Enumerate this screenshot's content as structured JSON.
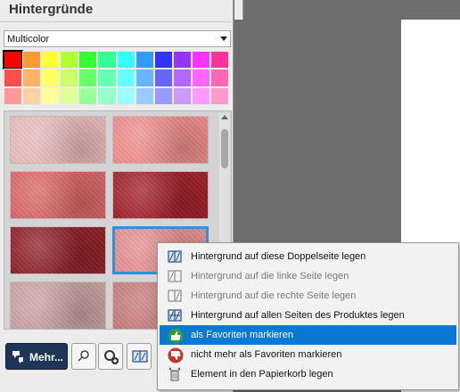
{
  "panel": {
    "title": "Hintergründe",
    "filter": {
      "value": "Multicolor"
    }
  },
  "palette": {
    "selected_index": 0,
    "rows": [
      [
        "#ff0000",
        "#ff9933",
        "#ffff33",
        "#b3ff33",
        "#33ff33",
        "#33ff99",
        "#33ffff",
        "#3399ff",
        "#3333ff",
        "#9933ff",
        "#ff33ff",
        "#ff3399"
      ],
      [
        "#ff4d4d",
        "#ffb366",
        "#ffff66",
        "#ccff66",
        "#66ff66",
        "#66ffb3",
        "#66ffff",
        "#66b3ff",
        "#6666ff",
        "#b366ff",
        "#ff66ff",
        "#ff66b3"
      ],
      [
        "#ff9999",
        "#ffd1a3",
        "#ffff99",
        "#e0ff99",
        "#99ff99",
        "#99ffcc",
        "#99ffff",
        "#99ccff",
        "#9999ff",
        "#cc99ff",
        "#ff99ff",
        "#ff99cc"
      ]
    ]
  },
  "gallery": {
    "tiles": [
      {
        "name": "pale-pink-grunge",
        "color": "#e9b9b9",
        "active": false
      },
      {
        "name": "coral-texture",
        "color": "#ef8c8c",
        "active": false
      },
      {
        "name": "brushed-red",
        "color": "#d96565",
        "active": false
      },
      {
        "name": "dark-red-grunge",
        "color": "#a11f2b",
        "active": false
      },
      {
        "name": "deep-red-vignette",
        "color": "#8e1f28",
        "active": false
      },
      {
        "name": "pink-linen",
        "color": "#e58f8f",
        "active": true
      },
      {
        "name": "crumpled-pink",
        "color": "#c9a2a2",
        "active": false
      },
      {
        "name": "red-canvas",
        "color": "#c77b7b",
        "active": false
      }
    ]
  },
  "toolbar": {
    "more_label": "Mehr..."
  },
  "context_menu": {
    "items": [
      {
        "label": "Hintergrund auf diese Doppelseite legen",
        "icon": "double-page-icon",
        "enabled": true,
        "highlighted": false
      },
      {
        "label": "Hintergrund auf die linke Seite legen",
        "icon": "left-page-icon",
        "enabled": false,
        "highlighted": false
      },
      {
        "label": "Hintergrund auf die rechte Seite legen",
        "icon": "right-page-icon",
        "enabled": false,
        "highlighted": false
      },
      {
        "label": "Hintergrund auf allen Seiten des Produktes legen",
        "icon": "all-pages-icon",
        "enabled": true,
        "highlighted": false
      },
      {
        "label": "als Favoriten markieren",
        "icon": "thumbs-up-icon",
        "enabled": true,
        "highlighted": true
      },
      {
        "label": "nicht mehr als Favoriten markieren",
        "icon": "thumbs-down-icon",
        "enabled": true,
        "highlighted": false
      },
      {
        "label": "Element in den Papierkorb legen",
        "icon": "trash-icon",
        "enabled": true,
        "highlighted": false
      }
    ]
  },
  "colors": {
    "accent": "#0a79d4",
    "more_button": "#1f3557",
    "active_tile_border": "#2f8fd8"
  }
}
